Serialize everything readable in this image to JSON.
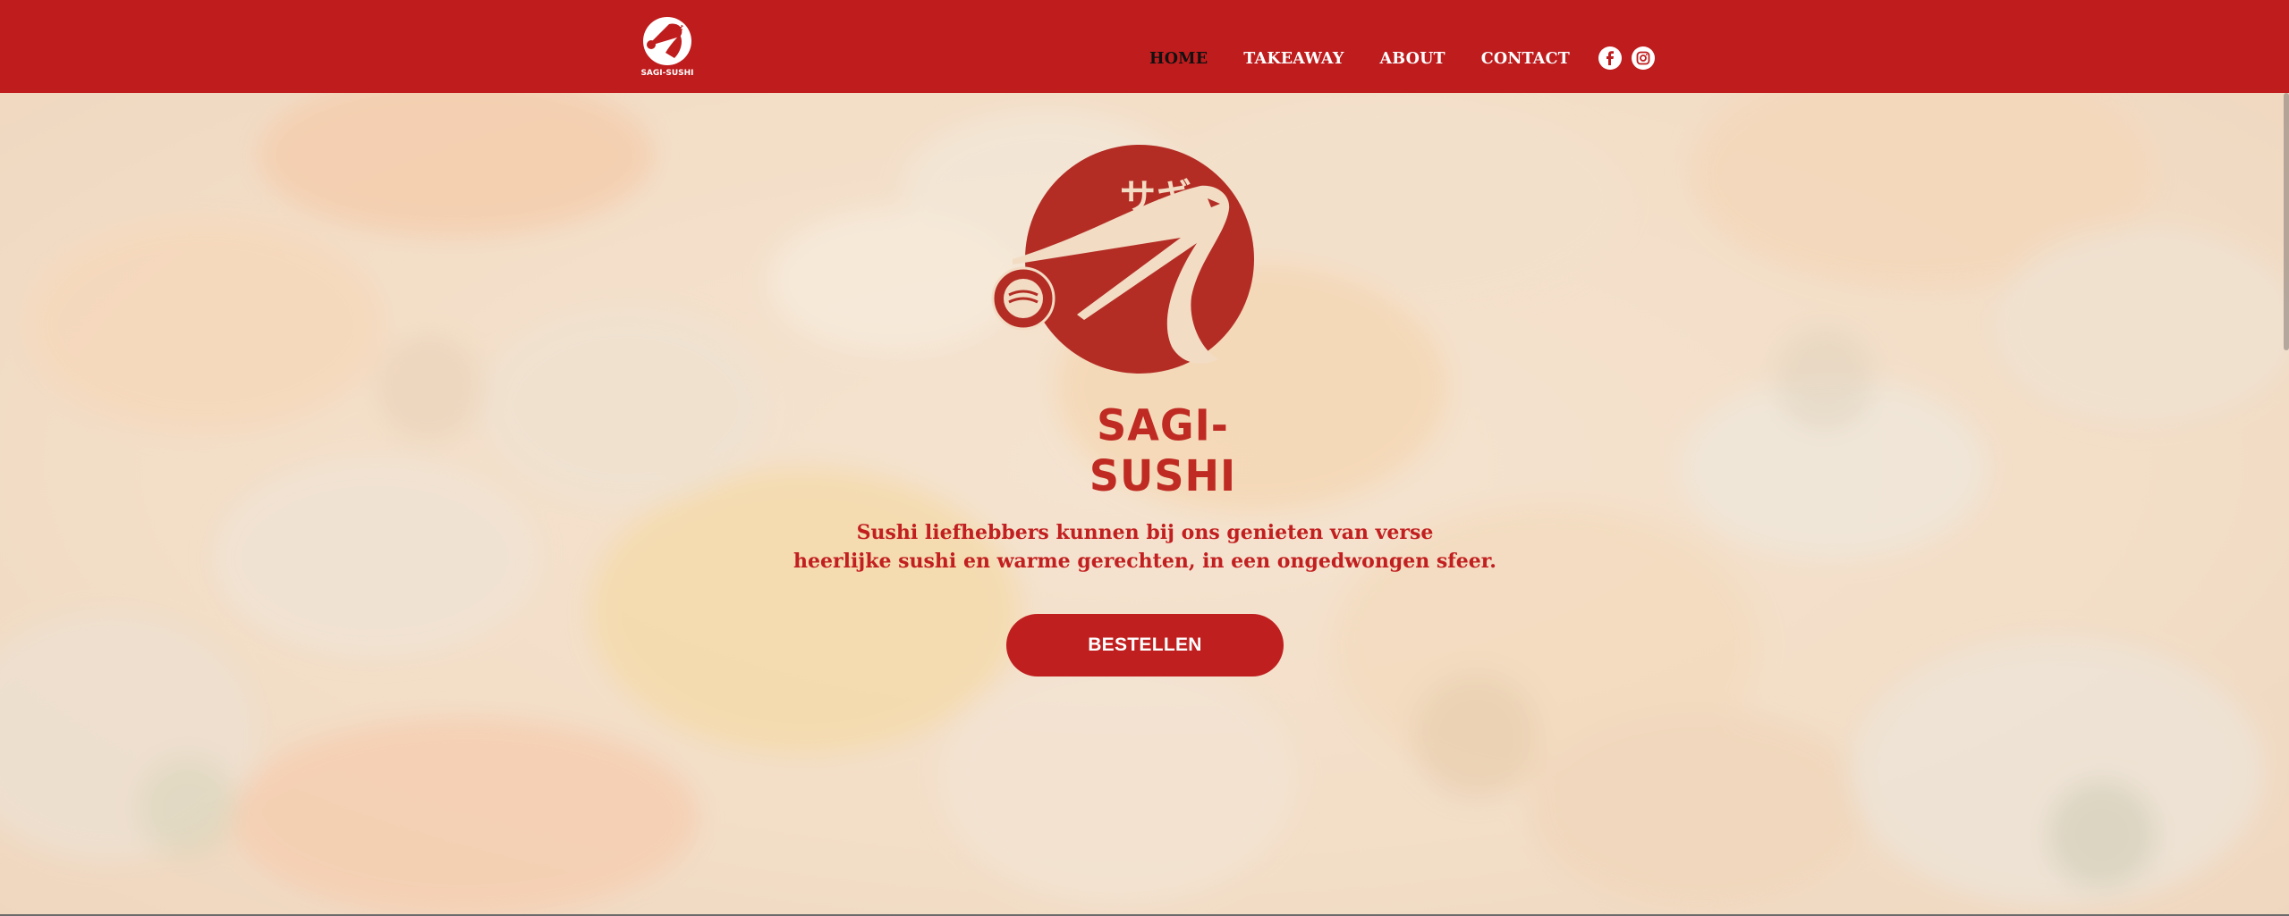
{
  "header": {
    "logo_alt": "SAGI-SUSHI",
    "nav": [
      {
        "label": "HOME",
        "active": true
      },
      {
        "label": "TAKEAWAY",
        "active": false
      },
      {
        "label": "ABOUT",
        "active": false
      },
      {
        "label": "CONTACT",
        "active": false
      }
    ],
    "social": [
      {
        "icon": "facebook-icon"
      },
      {
        "icon": "instagram-icon"
      }
    ]
  },
  "hero": {
    "logo_kana": "サギ",
    "brand_name": "SAGI-SUSHI",
    "tagline_line1": "Sushi liefhebbers kunnen bij ons genieten van verse",
    "tagline_line2": "heerlijke sushi en warme gerechten, in een ongedwongen sfeer.",
    "cta_label": "BESTELLEN"
  },
  "colors": {
    "brand_red": "#bf1c1d",
    "logo_red": "#b32d25",
    "text_red": "#c21f20",
    "cream": "#f3dcc4"
  }
}
